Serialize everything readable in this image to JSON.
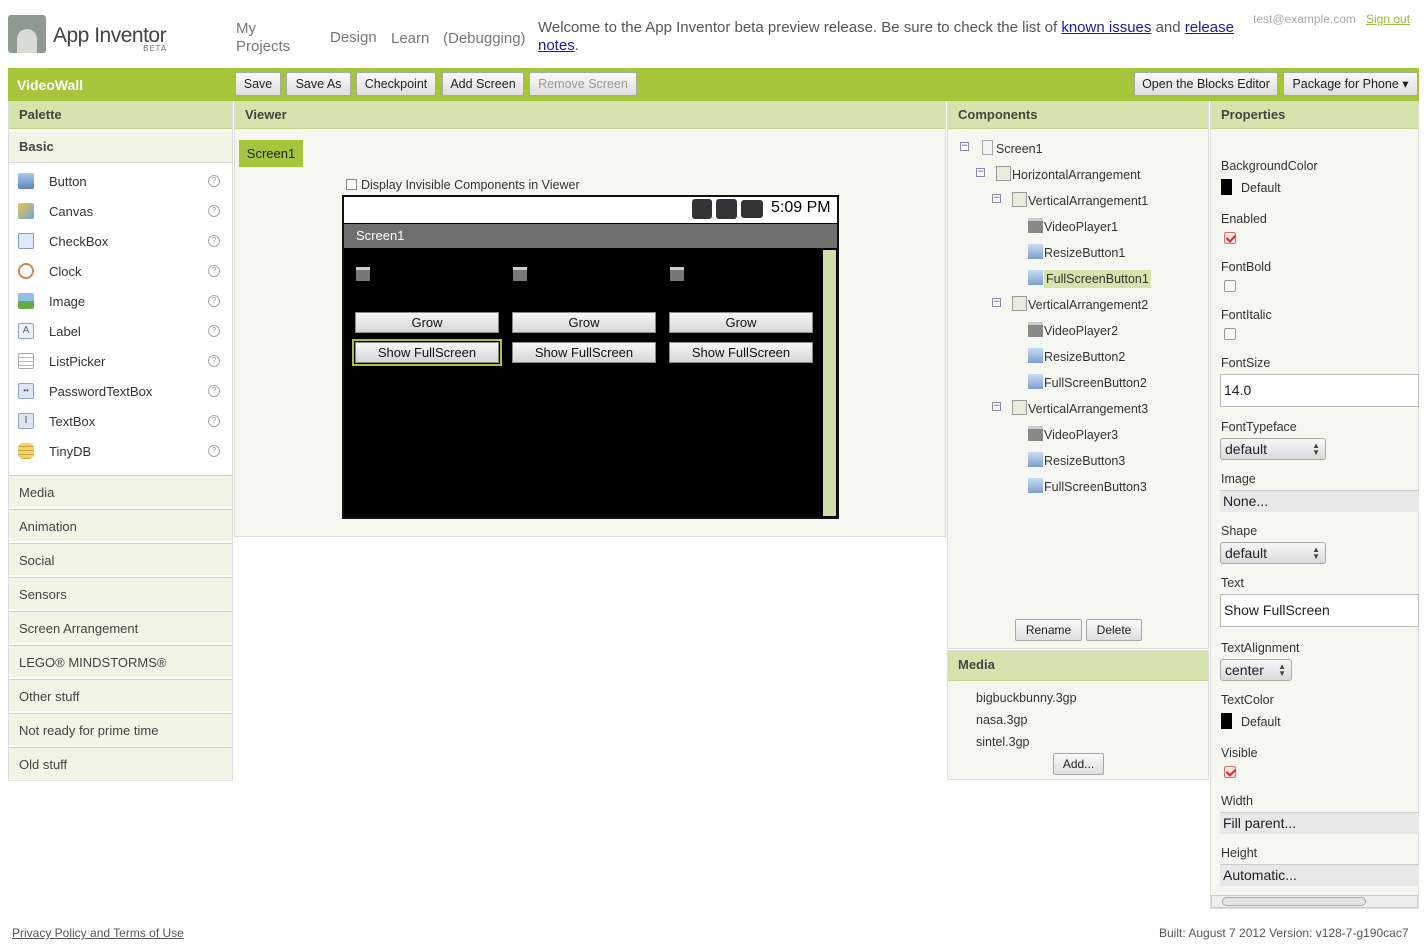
{
  "header": {
    "app_name": "App Inventor",
    "beta": "BETA",
    "nav": [
      "My Projects",
      "Design",
      "Learn",
      "(Debugging)"
    ],
    "welcome_text": "Welcome to the App Inventor beta preview release. Be sure to check the list of",
    "known_issues": "known issues",
    "and_text": "and",
    "release_notes": "release notes",
    "period": ".",
    "user_email": "test@example.com",
    "signout": "Sign out"
  },
  "toolbar": {
    "project_name": "VideoWall",
    "buttons": [
      "Save",
      "Save As",
      "Checkpoint",
      "Add Screen",
      "Remove Screen"
    ],
    "blocks_editor": "Open the Blocks Editor",
    "package": "Package for Phone ▾"
  },
  "palette": {
    "title": "Palette",
    "basic_title": "Basic",
    "items": [
      "Button",
      "Canvas",
      "CheckBox",
      "Clock",
      "Image",
      "Label",
      "ListPicker",
      "PasswordTextBox",
      "TextBox",
      "TinyDB"
    ],
    "help": "?",
    "categories": [
      "Media",
      "Animation",
      "Social",
      "Sensors",
      "Screen Arrangement",
      "LEGO® MINDSTORMS®",
      "Other stuff",
      "Not ready for prime time",
      "Old stuff"
    ]
  },
  "viewer": {
    "title": "Viewer",
    "screen_tab": "Screen1",
    "invisible_label": "Display Invisible Components in Viewer",
    "phone_time": "5:09 PM",
    "screen_title": "Screen1",
    "grow": [
      "Grow",
      "Grow",
      "Grow"
    ],
    "fullscreen": [
      "Show FullScreen",
      "Show FullScreen",
      "Show FullScreen"
    ]
  },
  "components": {
    "title": "Components",
    "tree": [
      "Screen1",
      "HorizontalArrangement",
      "VerticalArrangement1",
      "VideoPlayer1",
      "ResizeButton1",
      "FullScreenButton1",
      "VerticalArrangement2",
      "VideoPlayer2",
      "ResizeButton2",
      "FullScreenButton2",
      "VerticalArrangement3",
      "VideoPlayer3",
      "ResizeButton3",
      "FullScreenButton3"
    ],
    "rename": "Rename",
    "delete": "Delete"
  },
  "media": {
    "title": "Media",
    "files": [
      "bigbuckbunny.3gp",
      "nasa.3gp",
      "sintel.3gp"
    ],
    "add": "Add..."
  },
  "properties": {
    "title": "Properties",
    "background_color_label": "BackgroundColor",
    "background_color": "Default",
    "enabled_label": "Enabled",
    "enabled": true,
    "fontbold_label": "FontBold",
    "fontbold": false,
    "fontitalic_label": "FontItalic",
    "fontitalic": false,
    "fontsize_label": "FontSize",
    "fontsize": "14.0",
    "fonttypeface_label": "FontTypeface",
    "fonttypeface": "default",
    "image_label": "Image",
    "image": "None...",
    "shape_label": "Shape",
    "shape": "default",
    "text_label": "Text",
    "text": "Show FullScreen",
    "textalignment_label": "TextAlignment",
    "textalignment": "center",
    "textcolor_label": "TextColor",
    "textcolor": "Default",
    "visible_label": "Visible",
    "visible": true,
    "width_label": "Width",
    "width": "Fill parent...",
    "height_label": "Height",
    "height": "Automatic..."
  },
  "footer": {
    "privacy": "Privacy Policy and Terms of Use",
    "build": "Built: August 7 2012 Version: v128-7-g190cac7"
  },
  "colors": {
    "accent": "#a5c63b",
    "panel_header": "#d6e3ac"
  }
}
